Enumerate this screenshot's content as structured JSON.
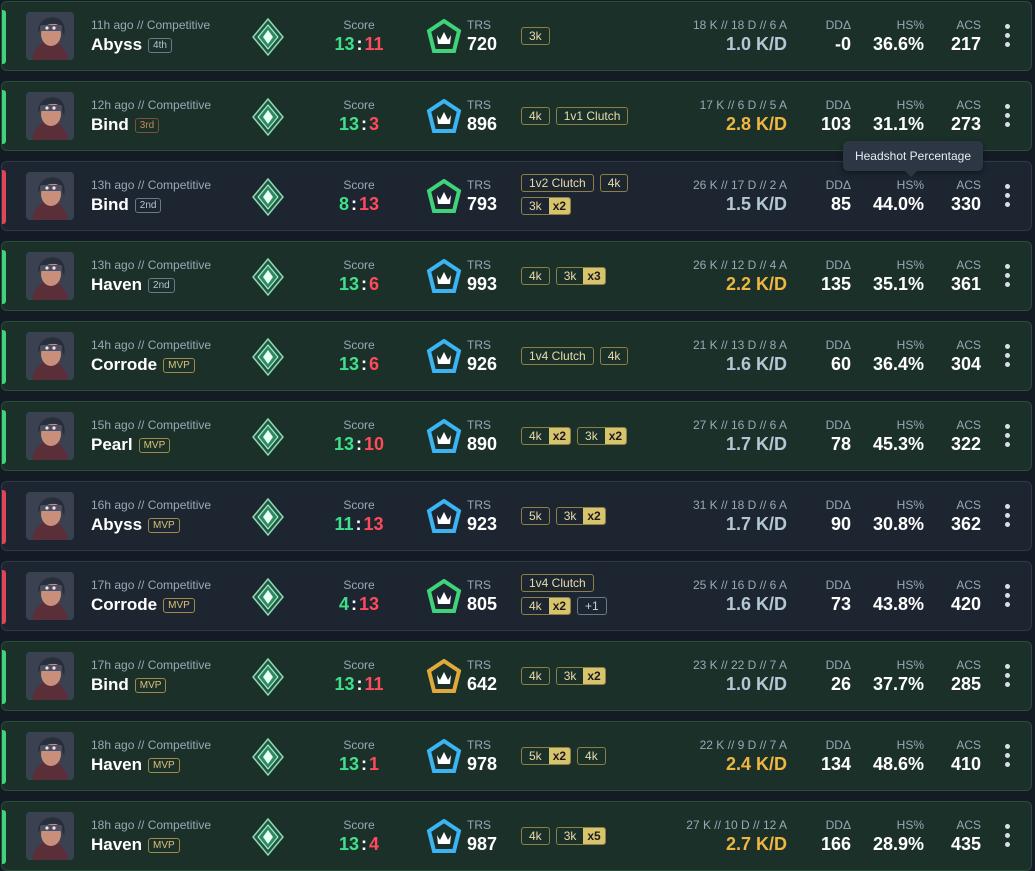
{
  "labels": {
    "score": "Score",
    "trs": "TRS",
    "dd": "DDΔ",
    "hs": "HS%",
    "acs": "ACS"
  },
  "tooltip": "Headshot Percentage",
  "colors": {
    "win": "#3fd37a",
    "loss": "#e0455a",
    "gold_kd": "#f2b640",
    "trs_blue": "#3ab4f2",
    "trs_green": "#3fd37a",
    "trs_gold": "#e0a93a"
  },
  "matches": [
    {
      "result": "win",
      "when": "11h ago // Competitive",
      "map": "Abyss",
      "place": "4th",
      "place_style": "normal",
      "avatar": "agent-avatar-icon",
      "score_a": "13",
      "score_b": "11",
      "trs_tier": "green",
      "trs": "720",
      "badges": [
        [
          {
            "t": "3k",
            "m": ""
          }
        ]
      ],
      "kda": "18 K // 18 D // 6 A",
      "kd": "1.0 K/D",
      "kd_gold": false,
      "dd": "-0",
      "hs": "36.6%",
      "acs": "217"
    },
    {
      "result": "win",
      "when": "12h ago // Competitive",
      "map": "Bind",
      "place": "3rd",
      "place_style": "bronze",
      "avatar": "agent-avatar-icon",
      "score_a": "13",
      "score_b": "3",
      "trs_tier": "blue",
      "trs": "896",
      "badges": [
        [
          {
            "t": "4k",
            "m": ""
          },
          {
            "t": "1v1 Clutch",
            "m": ""
          }
        ]
      ],
      "kda": "17 K // 6 D // 5 A",
      "kd": "2.8 K/D",
      "kd_gold": true,
      "dd": "103",
      "hs": "31.1%",
      "acs": "273"
    },
    {
      "result": "loss",
      "when": "13h ago // Competitive",
      "map": "Bind",
      "place": "2nd",
      "place_style": "normal",
      "avatar": "agent-avatar-icon",
      "score_a": "8",
      "score_b": "13",
      "trs_tier": "green",
      "trs": "793",
      "badges": [
        [
          {
            "t": "1v2 Clutch",
            "m": ""
          },
          {
            "t": "4k",
            "m": ""
          }
        ],
        [
          {
            "t": "3k",
            "m": "x2"
          }
        ]
      ],
      "kda": "26 K // 17 D // 2 A",
      "kd": "1.5 K/D",
      "kd_gold": false,
      "dd": "85",
      "hs": "44.0%",
      "acs": "330"
    },
    {
      "result": "win",
      "when": "13h ago // Competitive",
      "map": "Haven",
      "place": "2nd",
      "place_style": "normal",
      "avatar": "agent-avatar-icon",
      "score_a": "13",
      "score_b": "6",
      "trs_tier": "blue",
      "trs": "993",
      "badges": [
        [
          {
            "t": "4k",
            "m": ""
          },
          {
            "t": "3k",
            "m": "x3"
          }
        ]
      ],
      "kda": "26 K // 12 D // 4 A",
      "kd": "2.2 K/D",
      "kd_gold": true,
      "dd": "135",
      "hs": "35.1%",
      "acs": "361"
    },
    {
      "result": "win",
      "when": "14h ago // Competitive",
      "map": "Corrode",
      "place": "MVP",
      "place_style": "gold",
      "avatar": "agent-avatar-icon",
      "score_a": "13",
      "score_b": "6",
      "trs_tier": "blue",
      "trs": "926",
      "badges": [
        [
          {
            "t": "1v4 Clutch",
            "m": ""
          },
          {
            "t": "4k",
            "m": ""
          }
        ]
      ],
      "kda": "21 K // 13 D // 8 A",
      "kd": "1.6 K/D",
      "kd_gold": false,
      "dd": "60",
      "hs": "36.4%",
      "acs": "304"
    },
    {
      "result": "win",
      "when": "15h ago // Competitive",
      "map": "Pearl",
      "place": "MVP",
      "place_style": "gold",
      "avatar": "agent-avatar-alt-icon",
      "score_a": "13",
      "score_b": "10",
      "trs_tier": "blue",
      "trs": "890",
      "badges": [
        [
          {
            "t": "4k",
            "m": "x2"
          },
          {
            "t": "3k",
            "m": "x2"
          }
        ]
      ],
      "kda": "27 K // 16 D // 6 A",
      "kd": "1.7 K/D",
      "kd_gold": false,
      "dd": "78",
      "hs": "45.3%",
      "acs": "322"
    },
    {
      "result": "loss",
      "when": "16h ago // Competitive",
      "map": "Abyss",
      "place": "MVP",
      "place_style": "gold",
      "avatar": "agent-avatar-icon",
      "score_a": "11",
      "score_b": "13",
      "trs_tier": "blue",
      "trs": "923",
      "badges": [
        [
          {
            "t": "5k",
            "m": ""
          },
          {
            "t": "3k",
            "m": "x2"
          }
        ]
      ],
      "kda": "31 K // 18 D // 6 A",
      "kd": "1.7 K/D",
      "kd_gold": false,
      "dd": "90",
      "hs": "30.8%",
      "acs": "362"
    },
    {
      "result": "loss",
      "when": "17h ago // Competitive",
      "map": "Corrode",
      "place": "MVP",
      "place_style": "gold",
      "avatar": "agent-avatar-icon",
      "score_a": "4",
      "score_b": "13",
      "trs_tier": "green",
      "trs": "805",
      "badges": [
        [
          {
            "t": "1v4 Clutch",
            "m": ""
          }
        ],
        [
          {
            "t": "4k",
            "m": "x2"
          },
          {
            "t": "+1",
            "m": "",
            "plus": true
          }
        ]
      ],
      "kda": "25 K // 16 D // 6 A",
      "kd": "1.6 K/D",
      "kd_gold": false,
      "dd": "73",
      "hs": "43.8%",
      "acs": "420"
    },
    {
      "result": "win",
      "when": "17h ago // Competitive",
      "map": "Bind",
      "place": "MVP",
      "place_style": "gold",
      "avatar": "agent-avatar-icon",
      "score_a": "13",
      "score_b": "11",
      "trs_tier": "gold",
      "trs": "642",
      "badges": [
        [
          {
            "t": "4k",
            "m": ""
          },
          {
            "t": "3k",
            "m": "x2"
          }
        ]
      ],
      "kda": "23 K // 22 D // 7 A",
      "kd": "1.0 K/D",
      "kd_gold": false,
      "dd": "26",
      "hs": "37.7%",
      "acs": "285"
    },
    {
      "result": "win",
      "when": "18h ago // Competitive",
      "map": "Haven",
      "place": "MVP",
      "place_style": "gold",
      "avatar": "agent-avatar-icon",
      "score_a": "13",
      "score_b": "1",
      "trs_tier": "blue",
      "trs": "978",
      "badges": [
        [
          {
            "t": "5k",
            "m": "x2"
          },
          {
            "t": "4k",
            "m": ""
          }
        ]
      ],
      "kda": "22 K // 9 D // 7 A",
      "kd": "2.4 K/D",
      "kd_gold": true,
      "dd": "134",
      "hs": "48.6%",
      "acs": "410"
    },
    {
      "result": "win",
      "when": "18h ago // Competitive",
      "map": "Haven",
      "place": "MVP",
      "place_style": "gold",
      "avatar": "agent-avatar-icon",
      "score_a": "13",
      "score_b": "4",
      "trs_tier": "blue",
      "trs": "987",
      "badges": [
        [
          {
            "t": "4k",
            "m": ""
          },
          {
            "t": "3k",
            "m": "x5"
          }
        ]
      ],
      "kda": "27 K // 10 D // 12 A",
      "kd": "2.7 K/D",
      "kd_gold": true,
      "dd": "166",
      "hs": "28.9%",
      "acs": "435"
    }
  ]
}
